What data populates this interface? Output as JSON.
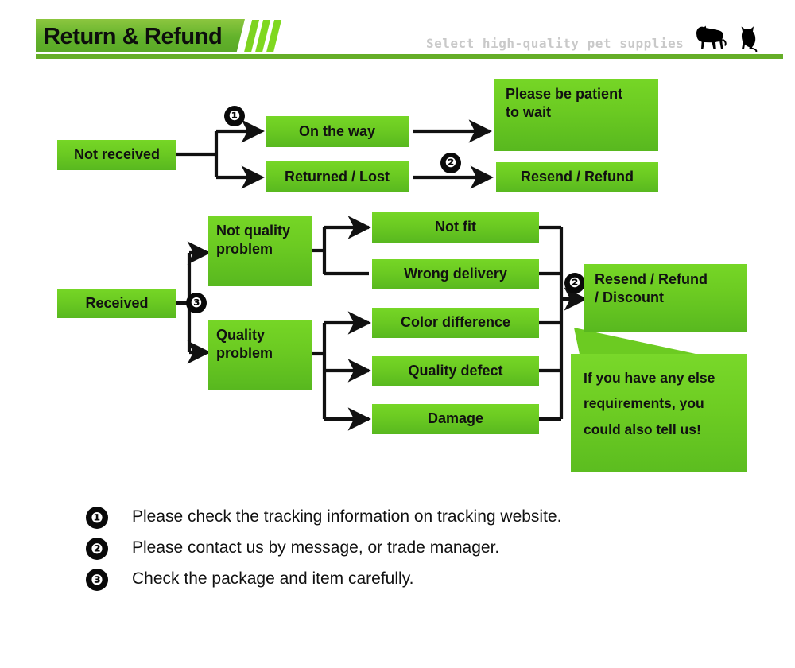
{
  "header": {
    "title": "Return & Refund",
    "tagline": "Select high-quality pet supplies",
    "accent_color": "#65ae28",
    "banner_gradient_top": "#8cc63f",
    "banner_gradient_bottom": "#5aa827",
    "pet_icons": [
      "dog-silhouette",
      "cat-silhouette"
    ]
  },
  "flow": {
    "box_color": "#6ccb22",
    "not_received": {
      "label": "Not received",
      "branches": [
        {
          "label": "On the way",
          "badge": "❶",
          "result": "Please be patient to wait",
          "result_line1": "Please be patient",
          "result_line2": "to wait"
        },
        {
          "label": "Returned / Lost",
          "badge": "❷",
          "result": "Resend / Refund"
        }
      ]
    },
    "received": {
      "label": "Received",
      "badge": "❸",
      "groups": [
        {
          "label_line1": "Not quality",
          "label_line2": "problem",
          "reasons": [
            "Not fit",
            "Wrong delivery"
          ]
        },
        {
          "label_line1": "Quality",
          "label_line2": "problem",
          "reasons": [
            "Color difference",
            "Quality defect",
            "Damage"
          ]
        }
      ],
      "outcome_badge": "❷",
      "outcome_line1": "Resend / Refund",
      "outcome_line2": "/ Discount",
      "bubble_line1": "If you have any else",
      "bubble_line2": "requirements, you",
      "bubble_line3": "could also tell us!"
    }
  },
  "notes": [
    {
      "badge": "❶",
      "text": "Please check the tracking information on tracking website."
    },
    {
      "badge": "❷",
      "text": "Please contact us by message, or trade manager."
    },
    {
      "badge": "❸",
      "text": "Check the package and item carefully."
    }
  ]
}
